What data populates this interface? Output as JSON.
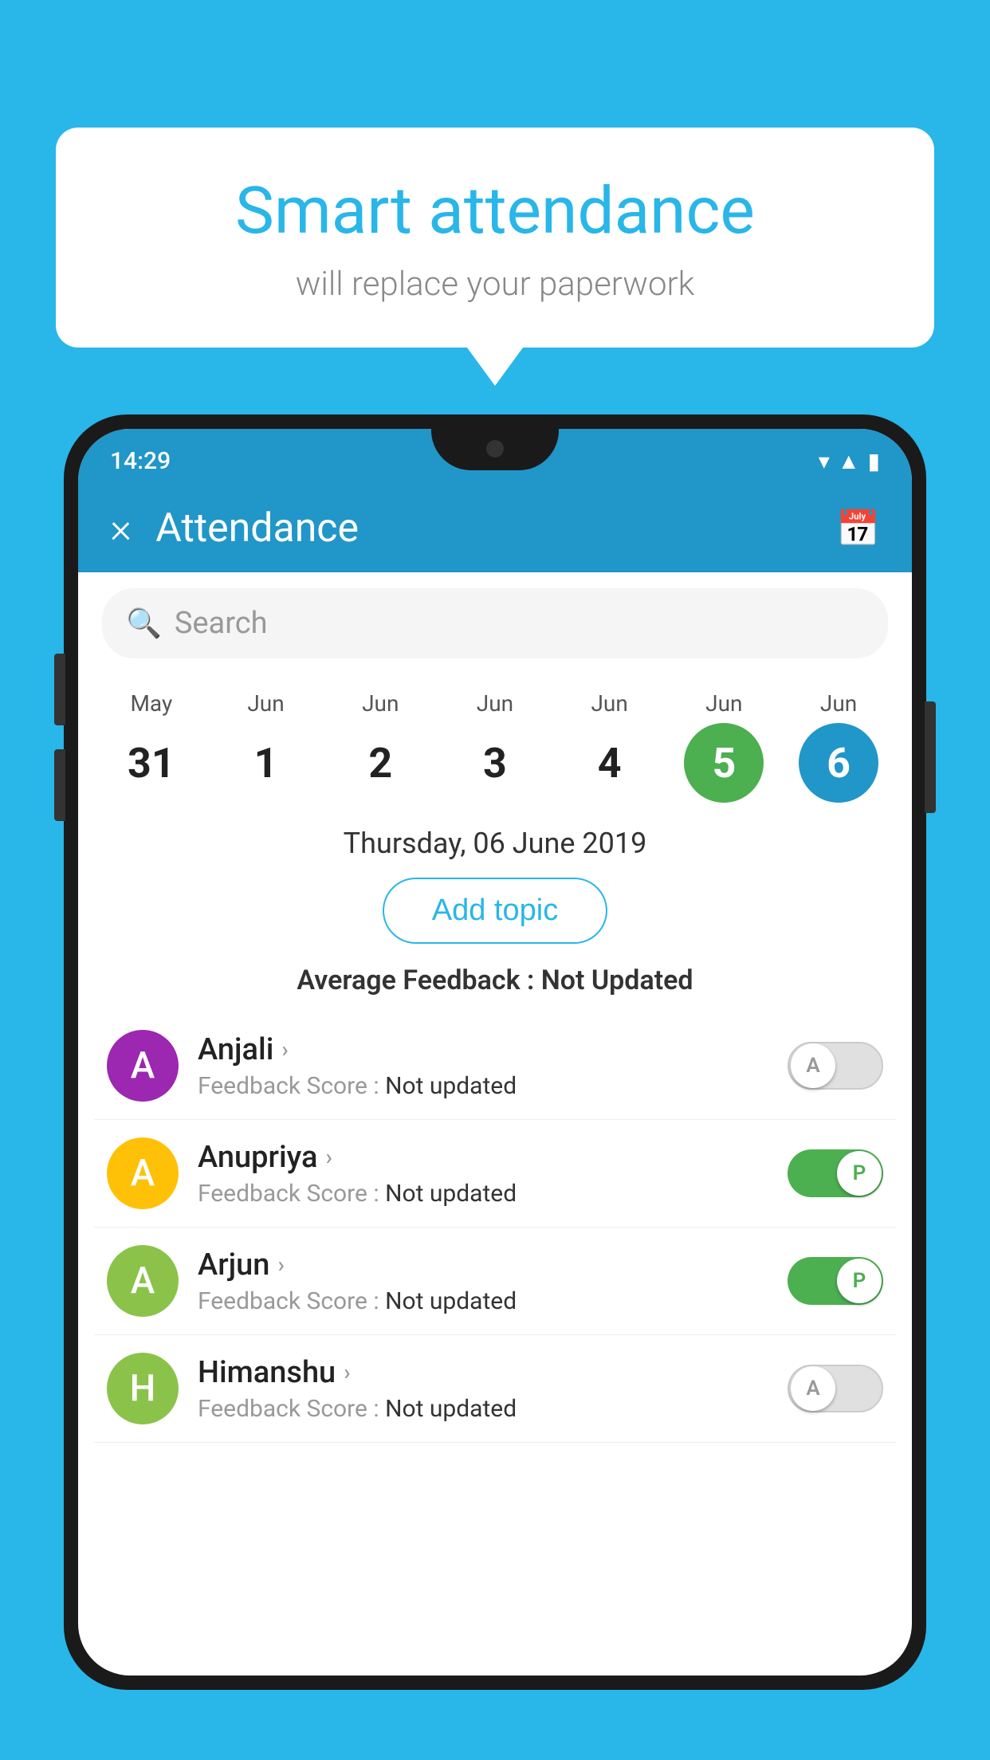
{
  "background_color": "#29B6E8",
  "speech_bubble": {
    "title": "Smart attendance",
    "subtitle": "will replace your paperwork"
  },
  "status_bar": {
    "time": "14:29",
    "wifi": "▾",
    "signal": "▲",
    "battery": "▮"
  },
  "app_bar": {
    "title": "Attendance",
    "close_label": "×",
    "calendar_icon": "📅"
  },
  "search": {
    "placeholder": "Search"
  },
  "calendar": {
    "days": [
      {
        "month": "May",
        "date": "31",
        "style": "normal"
      },
      {
        "month": "Jun",
        "date": "1",
        "style": "normal"
      },
      {
        "month": "Jun",
        "date": "2",
        "style": "normal"
      },
      {
        "month": "Jun",
        "date": "3",
        "style": "normal"
      },
      {
        "month": "Jun",
        "date": "4",
        "style": "normal"
      },
      {
        "month": "Jun",
        "date": "5",
        "style": "green"
      },
      {
        "month": "Jun",
        "date": "6",
        "style": "blue"
      }
    ]
  },
  "selected_date": "Thursday, 06 June 2019",
  "add_topic_label": "Add topic",
  "avg_feedback_label": "Average Feedback :",
  "avg_feedback_value": "Not Updated",
  "students": [
    {
      "name": "Anjali",
      "avatar_letter": "A",
      "avatar_color": "#9C27B0",
      "feedback_label": "Feedback Score :",
      "feedback_value": "Not updated",
      "toggle": "off",
      "toggle_letter": "A"
    },
    {
      "name": "Anupriya",
      "avatar_letter": "A",
      "avatar_color": "#FFC107",
      "feedback_label": "Feedback Score :",
      "feedback_value": "Not updated",
      "toggle": "on",
      "toggle_letter": "P"
    },
    {
      "name": "Arjun",
      "avatar_letter": "A",
      "avatar_color": "#8BC34A",
      "feedback_label": "Feedback Score :",
      "feedback_value": "Not updated",
      "toggle": "on",
      "toggle_letter": "P"
    },
    {
      "name": "Himanshu",
      "avatar_letter": "H",
      "avatar_color": "#8BC34A",
      "feedback_label": "Feedback Score :",
      "feedback_value": "Not updated",
      "toggle": "off",
      "toggle_letter": "A"
    }
  ]
}
